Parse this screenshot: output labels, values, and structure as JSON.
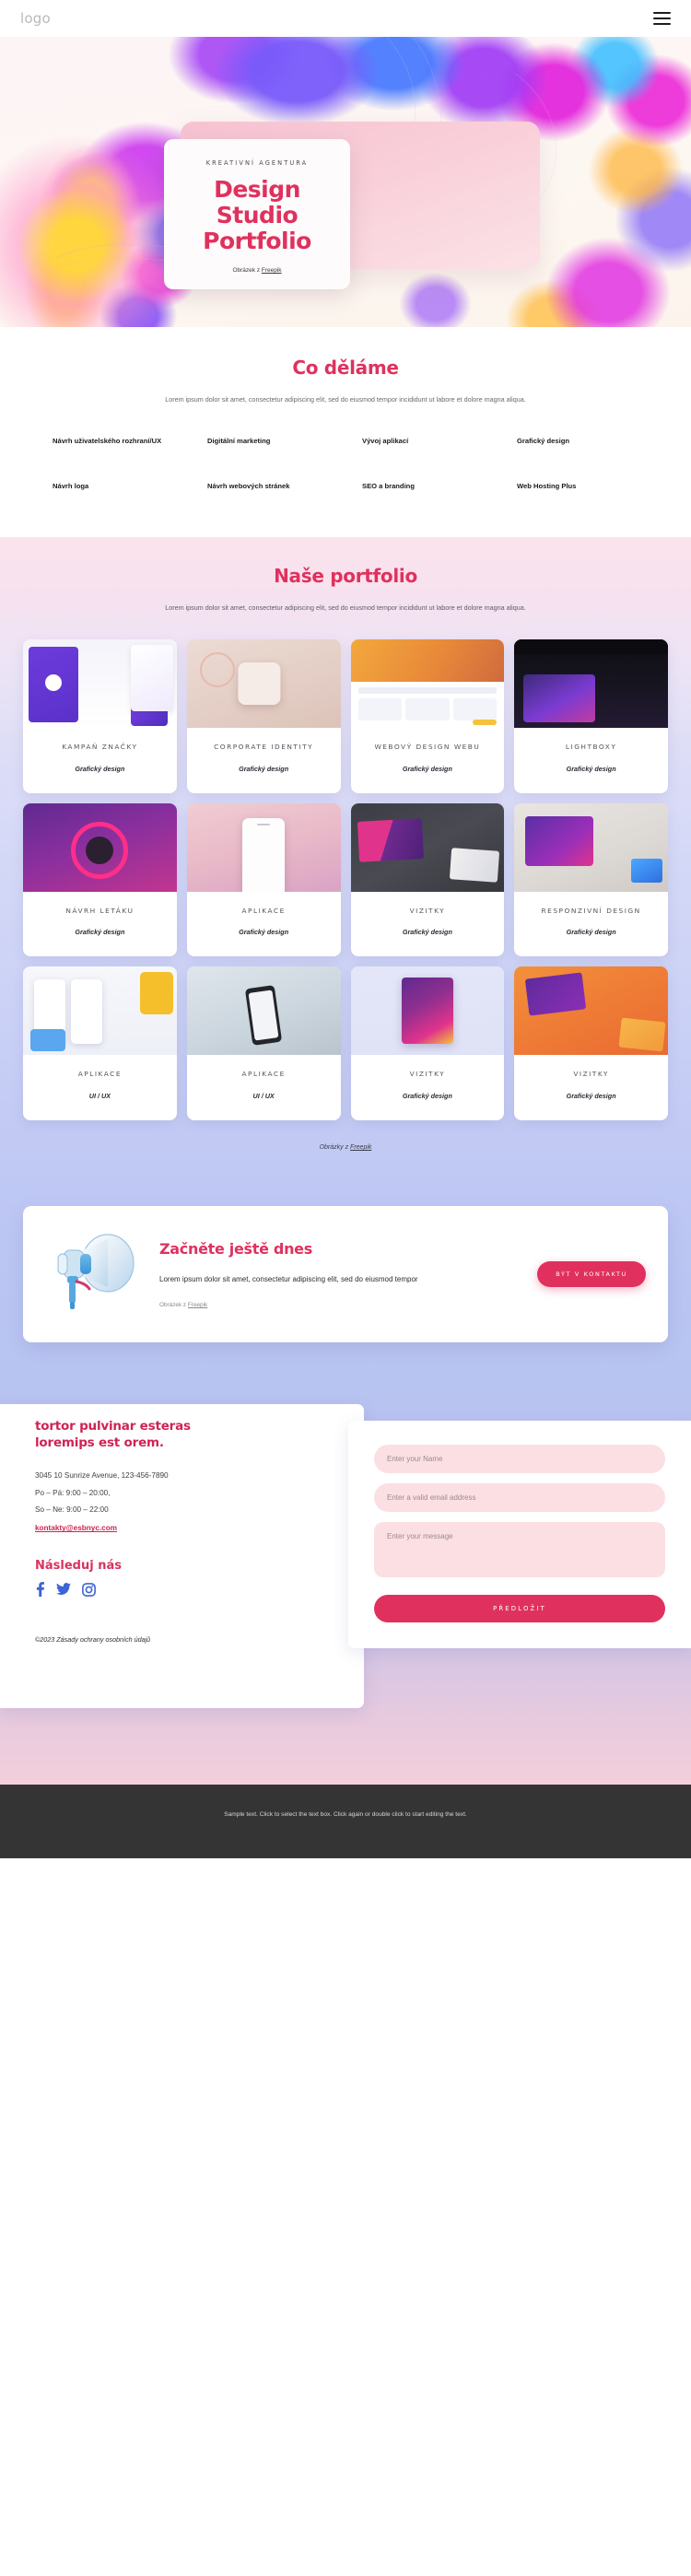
{
  "header": {
    "logo": "logo",
    "menu_icon": "hamburger-menu-icon"
  },
  "hero": {
    "eyebrow": "KREATIVNÍ AGENTURA",
    "title_line1": "Design",
    "title_line2": "Studio",
    "title_line3": "Portfolio",
    "credit_prefix": "Obrázek z ",
    "credit_link": "Freepik"
  },
  "services": {
    "title": "Co děláme",
    "subtitle": "Lorem ipsum dolor sit amet, consectetur adipiscing elit, sed do eiusmod tempor incididunt ut labore et dolore magna aliqua.",
    "items": [
      "Návrh uživatelského rozhraní/UX",
      "Digitální marketing",
      "Vývoj aplikací",
      "Grafický design",
      "Návrh loga",
      "Návrh webových stránek",
      "SEO a branding",
      "Web Hosting Plus"
    ]
  },
  "portfolio": {
    "title": "Naše portfolio",
    "subtitle": "Lorem ipsum dolor sit amet, consectetur adipiscing elit, sed do eiusmod tempor incididunt ut labore et dolore magna aliqua.",
    "credit_prefix": "Obrázky z ",
    "credit_link": "Freepik",
    "cards": [
      {
        "title": "KAMPAŇ ZNAČKY",
        "tag": "Grafický design",
        "thumb": "t1"
      },
      {
        "title": "CORPORATE IDENTITY",
        "tag": "Grafický design",
        "thumb": "t2"
      },
      {
        "title": "WEBOVÝ DESIGN WEBU",
        "tag": "Grafický design",
        "thumb": "t3"
      },
      {
        "title": "LIGHTBOXY",
        "tag": "Grafický design",
        "thumb": "t4"
      },
      {
        "title": "NÁVRH LETÁKU",
        "tag": "Grafický design",
        "thumb": "t5"
      },
      {
        "title": "APLIKACE",
        "tag": "Grafický design",
        "thumb": "t6"
      },
      {
        "title": "VIZITKY",
        "tag": "Grafický design",
        "thumb": "t7"
      },
      {
        "title": "RESPONZIVNÍ DESIGN",
        "tag": "Grafický design",
        "thumb": "t8"
      },
      {
        "title": "APLIKACE",
        "tag": "UI / UX",
        "thumb": "t9"
      },
      {
        "title": "APLIKACE",
        "tag": "UI / UX",
        "thumb": "t10"
      },
      {
        "title": "VIZITKY",
        "tag": "Grafický design",
        "thumb": "t11"
      },
      {
        "title": "VIZITKY",
        "tag": "Grafický design",
        "thumb": "t12"
      }
    ]
  },
  "cta": {
    "title": "Začněte ještě dnes",
    "body": "Lorem ipsum dolor sit amet, consectetur adipiscing elit, sed do eiusmod tempor",
    "credit_prefix": "Obrázek z ",
    "credit_link": "Freepik",
    "button": "BÝT V KONTAKTU",
    "image_name": "megaphone-illustration"
  },
  "contact": {
    "heading_line1": "tortor pulvinar esteras",
    "heading_line2": "loremips est orem.",
    "address": "3045 10 Sunrize Avenue, 123-456-7890",
    "hours_weekday": "Po – Pá: 9:00 – 20:00,",
    "hours_weekend": "So – Ne: 9:00 – 22:00",
    "email": "kontakty@esbnyc.com",
    "follow_title": "Následuj nás",
    "socials": [
      "facebook-icon",
      "twitter-icon",
      "instagram-icon"
    ],
    "copyright": "©2023 Zásady ochrany osobních údajů"
  },
  "form": {
    "name_placeholder": "Enter your Name",
    "name_value": "",
    "email_placeholder": "Enter a valid email address",
    "email_value": "",
    "message_placeholder": "Enter your message",
    "message_value": "",
    "submit_label": "PŘEDLOŽIT"
  },
  "bottom": {
    "text": "Sample text. Click to select the text box. Click again or double click to start editing the text."
  },
  "colors": {
    "accent": "#e0315e",
    "accent_dark": "#cf2352",
    "field_bg": "#fbdfe3",
    "bottom_bar": "#343434"
  }
}
